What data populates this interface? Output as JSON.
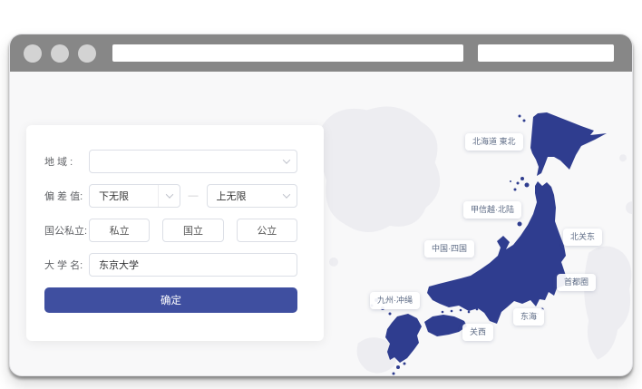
{
  "form": {
    "region": {
      "label": "地 域 :",
      "value": ""
    },
    "deviation": {
      "label": "偏 差 值:",
      "lower_value": "下无限",
      "separator": "—",
      "upper_value": "上无限"
    },
    "school_type": {
      "label": "国公私立:",
      "options": [
        "私立",
        "国立",
        "公立"
      ]
    },
    "university": {
      "label": "大 学 名:",
      "value": "东京大学"
    },
    "submit_label": "确定"
  },
  "map": {
    "regions": [
      {
        "label": "北海道 東北"
      },
      {
        "label": "甲信越·北陆"
      },
      {
        "label": "北关东"
      },
      {
        "label": "中国·四国"
      },
      {
        "label": "首都圈"
      },
      {
        "label": "九州·冲绳"
      },
      {
        "label": "东海"
      },
      {
        "label": "关西"
      }
    ]
  },
  "colors": {
    "primary_button": "#3f4fa0",
    "map_fill": "#2f3d8f",
    "titlebar": "#878787",
    "content_background": "#f8f8f9",
    "label_text": "#606266",
    "pill_text": "#5d6b85"
  }
}
